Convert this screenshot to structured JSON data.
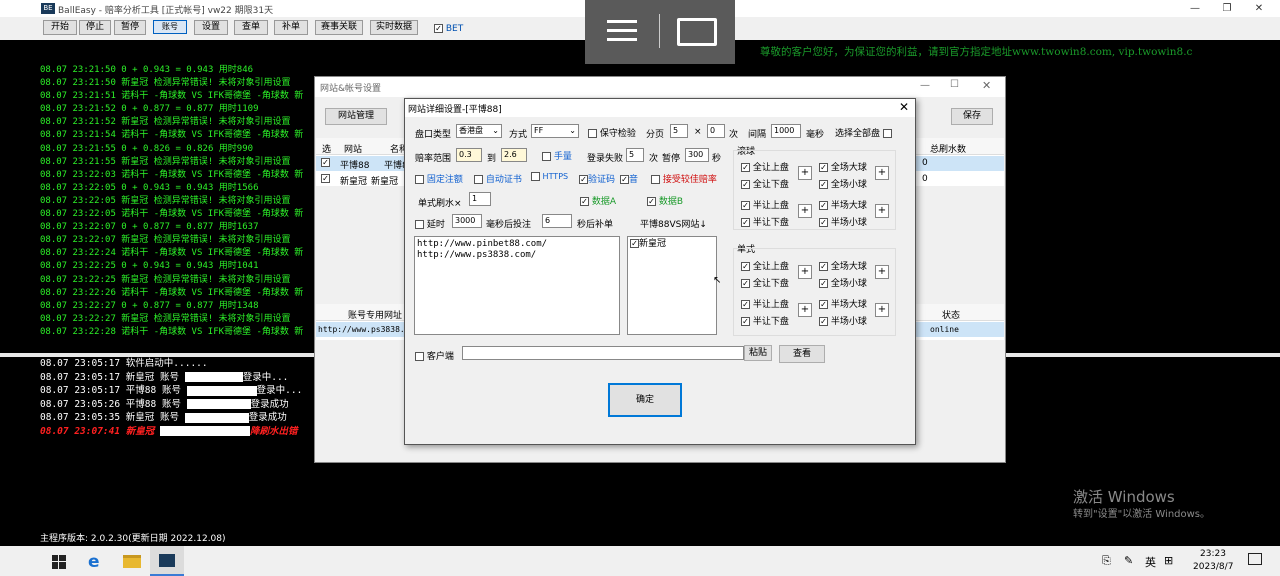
{
  "app": {
    "title": "BallEasy - 赔率分析工具 [正式帐号] vw22 期限31天",
    "logo": "BE"
  },
  "toolbar": {
    "buttons": [
      "开始",
      "停止",
      "暂停",
      "账号",
      "设置",
      "查单",
      "补单",
      "赛事关联",
      "实时数据"
    ],
    "bet_label": "BET",
    "bet_checked": true
  },
  "notice": "尊敬的客户您好，为保证您的利益，请到官方指定地址www.twowin8.com, vip.twowin8.c",
  "log": [
    "08.07 23:21:50 0 + 0.943 = 0.943 用时846",
    "08.07 23:21:50 新皇冠 检测异常错误! 未将对象引用设置",
    "08.07 23:21:51 诺科干 -角球数 VS IFK哥德堡 -角球数 新",
    "08.07 23:21:52 0 + 0.877 = 0.877 用时1109",
    "08.07 23:21:52 新皇冠 检测异常错误! 未将对象引用设置",
    "08.07 23:21:54 诺科干 -角球数 VS IFK哥德堡 -角球数 新",
    "08.07 23:21:55 0 + 0.826 = 0.826 用时990",
    "08.07 23:21:55 新皇冠 检测异常错误! 未将对象引用设置",
    "08.07 23:22:03 诺科干 -角球数 VS IFK哥德堡 -角球数 新",
    "08.07 23:22:05 0 + 0.943 = 0.943 用时1566",
    "08.07 23:22:05 新皇冠 检测异常错误! 未将对象引用设置",
    "08.07 23:22:05 诺科干 -角球数 VS IFK哥德堡 -角球数 新",
    "08.07 23:22:07 0 + 0.877 = 0.877 用时1637",
    "08.07 23:22:07 新皇冠 检测异常错误! 未将对象引用设置",
    "08.07 23:22:24 诺科干 -角球数 VS IFK哥德堡 -角球数 新",
    "08.07 23:22:25 0 + 0.943 = 0.943 用时1041",
    "08.07 23:22:25 新皇冠 检测异常错误! 未将对象引用设置",
    "08.07 23:22:26 诺科干 -角球数 VS IFK哥德堡 -角球数 新",
    "08.07 23:22:27 0 + 0.877 = 0.877 用时1348",
    "08.07 23:22:27 新皇冠 检测异常错误! 未将对象引用设置",
    "08.07 23:22:28 诺科干 -角球数 VS IFK哥德堡 -角球数 新"
  ],
  "log2": {
    "l1": "08.07 23:05:17 软件启动中......",
    "l2a": "08.07 23:05:17 新皇冠 账号 ",
    "l2b": "登录中...",
    "l3a": "08.07 23:05:17 平博88 账号 ",
    "l3b": "登录中...",
    "l4a": "08.07 23:05:26 平博88 账号 ",
    "l4b": "登录成功",
    "l5a": "08.07 23:05:35 新皇冠 账号 ",
    "l5b": "登录成功",
    "l6a": "08.07 23:07:41 新皇冠 ",
    "l6b": "降刷水出错"
  },
  "status": "主程序版本: 2.0.2.30(更新日期 2022.12.08)",
  "watermark": {
    "title": "激活 Windows",
    "sub": "转到\"设置\"以激活 Windows。"
  },
  "taskbar": {
    "time": "23:23",
    "date": "2023/8/7",
    "lang": "英"
  },
  "acct_window": {
    "title": "网站&帐号设置",
    "manage_btn": "网站管理",
    "save_btn": "保存",
    "cols": [
      "选",
      "网站",
      "名称"
    ],
    "col_right": "总刷水数",
    "rows": [
      {
        "site": "平博88",
        "name": "平博8",
        "count": "0"
      },
      {
        "site": "新皇冠",
        "name": "新皇冠",
        "count": "0"
      }
    ],
    "url_header": "账号专用网址",
    "state_header": "状态",
    "url_row": "http://www.ps3838.co",
    "state_row": "online"
  },
  "dialog": {
    "title": "网站详细设置-[平博88]",
    "pan_type_label": "盘口类型",
    "pan_type": "香港盘",
    "mode_label": "方式",
    "mode": "FF",
    "keep_label": "保守检验",
    "page_label": "分页",
    "page_a": "5",
    "x": "×",
    "page_b": "0",
    "times": "次",
    "interval_label": "间隔",
    "interval": "1000",
    "ms": "毫秒",
    "allpan_label": "选择全部盘",
    "odds_label": "赔率范围",
    "odds_min": "0.3",
    "to": "到",
    "odds_max": "2.6",
    "manual_label": "手量",
    "fail_label": "登录失败",
    "fail_n": "5",
    "times2": "次",
    "pause_label": "暂停",
    "pause_s": "300",
    "sec": "秒",
    "fixed_label": "固定注额",
    "auto_cert": "自动证书",
    "https": "HTTPS",
    "captcha": "验证码",
    "sound": "音",
    "accept_better": "接受较佳赔率",
    "single_label": "单式刷水×",
    "single_n": "1",
    "dataA": "数据A",
    "dataB": "数据B",
    "delay_label": "延时",
    "delay_ms": "3000",
    "delay_after": "毫秒后投注",
    "supp_n": "6",
    "supp_label": "秒后补单",
    "vs_label": "平博88VS网站↓",
    "urls": [
      "http://www.pinbet88.com/",
      "http://www.ps3838.com/"
    ],
    "sites": [
      "新皇冠"
    ],
    "client_label": "客户端",
    "paste_btn": "粘贴",
    "view_btn": "查看",
    "ok_btn": "确定",
    "rolling_title": "滚球",
    "single_title": "单式",
    "opts": {
      "full_up": "全让上盘",
      "full_down": "全让下盘",
      "full_big": "全场大球",
      "full_small": "全场小球",
      "half_up": "半让上盘",
      "half_down": "半让下盘",
      "half_big": "半场大球",
      "half_small": "半场小球"
    },
    "plus": "+"
  }
}
